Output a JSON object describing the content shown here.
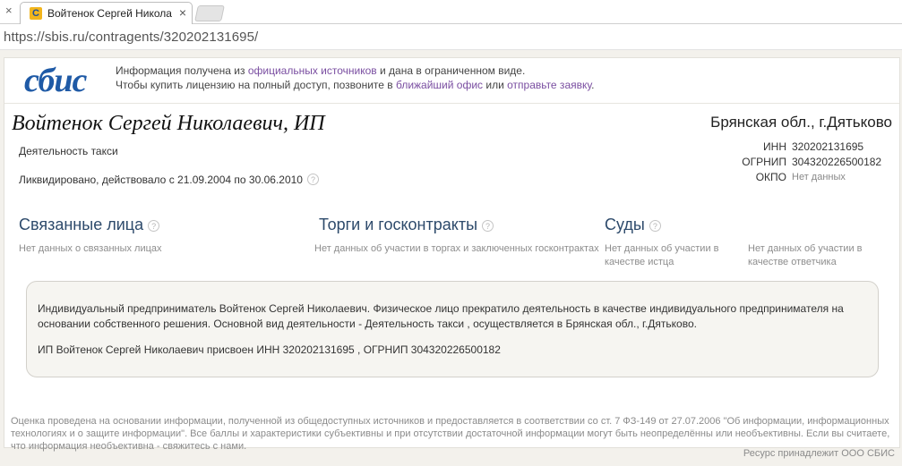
{
  "browser": {
    "tab_title": "Войтенок Сергей Никола",
    "url": "https://sbis.ru/contragents/320202131695/"
  },
  "brand": {
    "logo_text": "СБИС",
    "color": "#1f5aa6"
  },
  "notice": {
    "line1_a": "Информация получена из ",
    "link_sources": "официальных источников",
    "line1_b": " и дана в ограниченном виде.",
    "line2_a": "Чтобы купить лицензию на полный доступ, позвоните в ",
    "link_office": "ближайший офис",
    "line2_b": " или ",
    "link_request": "отправьте заявку",
    "line2_c": "."
  },
  "company": {
    "name": "Войтенок Сергей Николаевич, ИП",
    "activity": "Деятельность такси",
    "status": "Ликвидировано, действовало с 21.09.2004 по 30.06.2010",
    "region": "Брянская обл., г.Дятьково",
    "codes": [
      {
        "label": "ИНН",
        "value": "320202131695"
      },
      {
        "label": "ОГРНИП",
        "value": "304320226500182"
      },
      {
        "label": "ОКПО",
        "value": "Нет данных"
      }
    ]
  },
  "sections": {
    "related": {
      "title": "Связанные лица",
      "note": "Нет данных о связанных лицах"
    },
    "tenders": {
      "title": "Торги и госконтракты",
      "note": "Нет данных об участии в торгах и заключенных госконтрактах"
    },
    "courts": {
      "title": "Суды",
      "note_plaintiff": "Нет данных об участии в качестве истца",
      "note_defendant": "Нет данных об участии в качестве ответчика"
    }
  },
  "description": {
    "paragraph1": "Индивидуальный предприниматель Войтенок Сергей Николаевич. Физическое лицо прекратило деятельность в качестве индивидуального предпринимателя на основании собственного решения. Основной вид деятельности - Деятельность такси , осуществляется в Брянская обл., г.Дятьково.",
    "paragraph2": "ИП Войтенок Сергей Николаевич присвоен ИНН 320202131695 , ОГРНИП 304320226500182"
  },
  "footer": {
    "disclaimer": "Оценка проведена на основании информации, полученной из общедоступных источников и предоставляется в соответствии со ст. 7 ФЗ-149 от 27.07.2006 \"Об информации, информационных технологиях и о защите информации\". Все баллы и характеристики субъективны и при отсутствии достаточной информации могут быть неопределённы или необъективны. Если вы считаете, что информация необъективна - свяжитесь с нами.",
    "owner": "Ресурс принадлежит ООО СБИС"
  }
}
